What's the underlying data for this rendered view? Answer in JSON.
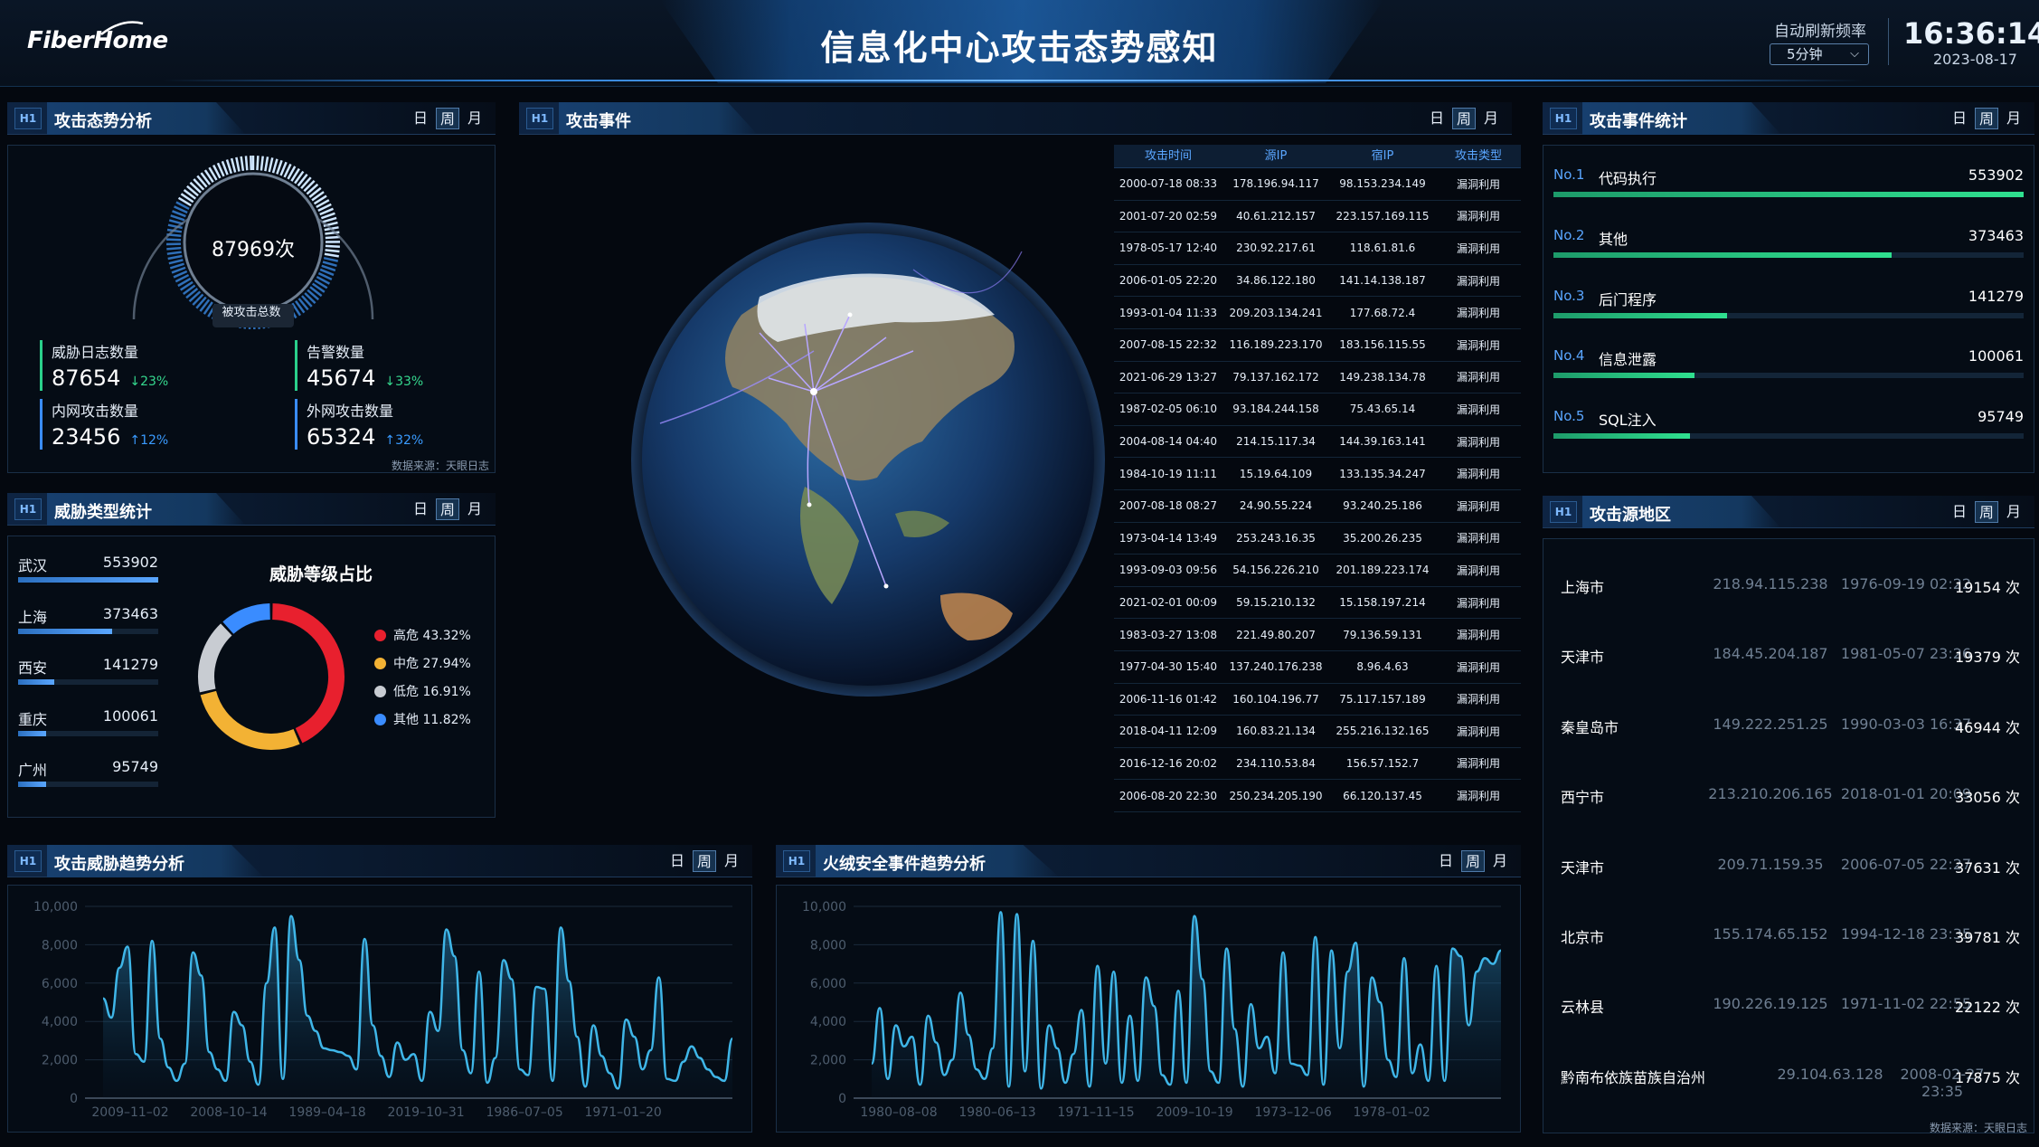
{
  "header": {
    "logo": "FiberHome",
    "title": "信息化中心攻击态势感知",
    "refresh_label": "自动刷新频率",
    "refresh_value": "5分钟",
    "time": "16:36:14",
    "date": "2023-08-17"
  },
  "tabs": {
    "day": "日",
    "week": "周",
    "month": "月"
  },
  "panel_icon_text": "H1",
  "attack_posture": {
    "title": "攻击态势分析",
    "total_value": "87969次",
    "total_label": "被攻击总数",
    "stats": [
      {
        "label": "威胁日志数量",
        "value": "87654",
        "change": "↓23%",
        "direction": "down"
      },
      {
        "label": "告警数量",
        "value": "45674",
        "change": "↓33%",
        "direction": "down"
      },
      {
        "label": "内网攻击数量",
        "value": "23456",
        "change": "↑12%",
        "direction": "up"
      },
      {
        "label": "外网攻击数量",
        "value": "65324",
        "change": "↑32%",
        "direction": "up"
      }
    ],
    "source": "数据来源：天眼日志"
  },
  "threat_type": {
    "title": "威胁类型统计",
    "cities": [
      {
        "name": "武汉",
        "value": "553902",
        "ratio": 1.0
      },
      {
        "name": "上海",
        "value": "373463",
        "ratio": 0.67
      },
      {
        "name": "西安",
        "value": "141279",
        "ratio": 0.26
      },
      {
        "name": "重庆",
        "value": "100061",
        "ratio": 0.2
      },
      {
        "name": "广州",
        "value": "95749",
        "ratio": 0.2
      }
    ],
    "donut_title": "威胁等级占比",
    "levels": [
      {
        "label": "高危 43.32%",
        "pct": 43.32,
        "color": "#e8202e"
      },
      {
        "label": "中危 27.94%",
        "pct": 27.94,
        "color": "#f3b234"
      },
      {
        "label": "低危 16.91%",
        "pct": 16.91,
        "color": "#c8ccd2"
      },
      {
        "label": "其他 11.82%",
        "pct": 11.82,
        "color": "#3a8cff"
      }
    ]
  },
  "attack_events": {
    "title": "攻击事件",
    "columns": [
      "攻击时间",
      "源IP",
      "宿IP",
      "攻击类型"
    ],
    "rows": [
      [
        "2000-07-18 08:33",
        "178.196.94.117",
        "98.153.234.149",
        "漏洞利用"
      ],
      [
        "2001-07-20 02:59",
        "40.61.212.157",
        "223.157.169.115",
        "漏洞利用"
      ],
      [
        "1978-05-17 12:40",
        "230.92.217.61",
        "118.61.81.6",
        "漏洞利用"
      ],
      [
        "2006-01-05 22:20",
        "34.86.122.180",
        "141.14.138.187",
        "漏洞利用"
      ],
      [
        "1993-01-04 11:33",
        "209.203.134.241",
        "177.68.72.4",
        "漏洞利用"
      ],
      [
        "2007-08-15 22:32",
        "116.189.223.170",
        "183.156.115.55",
        "漏洞利用"
      ],
      [
        "2021-06-29 13:27",
        "79.137.162.172",
        "149.238.134.78",
        "漏洞利用"
      ],
      [
        "1987-02-05 06:10",
        "93.184.244.158",
        "75.43.65.14",
        "漏洞利用"
      ],
      [
        "2004-08-14 04:40",
        "214.15.117.34",
        "144.39.163.141",
        "漏洞利用"
      ],
      [
        "1984-10-19 11:11",
        "15.19.64.109",
        "133.135.34.247",
        "漏洞利用"
      ],
      [
        "2007-08-18 08:27",
        "24.90.55.224",
        "93.240.25.186",
        "漏洞利用"
      ],
      [
        "1973-04-14 13:49",
        "253.243.16.35",
        "35.200.26.235",
        "漏洞利用"
      ],
      [
        "1993-09-03 09:56",
        "54.156.226.210",
        "201.189.223.174",
        "漏洞利用"
      ],
      [
        "2021-02-01 00:09",
        "59.15.210.132",
        "15.158.197.214",
        "漏洞利用"
      ],
      [
        "1983-03-27 13:08",
        "221.49.80.207",
        "79.136.59.131",
        "漏洞利用"
      ],
      [
        "1977-04-30 15:40",
        "137.240.176.238",
        "8.96.4.63",
        "漏洞利用"
      ],
      [
        "2006-11-16 01:42",
        "160.104.196.77",
        "75.117.157.189",
        "漏洞利用"
      ],
      [
        "2018-04-11 12:09",
        "160.83.21.134",
        "255.216.132.165",
        "漏洞利用"
      ],
      [
        "2016-12-16 20:02",
        "234.110.53.84",
        "156.57.152.7",
        "漏洞利用"
      ],
      [
        "2006-08-20 22:30",
        "250.234.205.190",
        "66.120.137.45",
        "漏洞利用"
      ]
    ]
  },
  "event_stats": {
    "title": "攻击事件统计",
    "items": [
      {
        "no": "No.1",
        "name": "代码执行",
        "value": "553902",
        "ratio": 1.0
      },
      {
        "no": "No.2",
        "name": "其他",
        "value": "373463",
        "ratio": 0.72
      },
      {
        "no": "No.3",
        "name": "后门程序",
        "value": "141279",
        "ratio": 0.37
      },
      {
        "no": "No.4",
        "name": "信息泄露",
        "value": "100061",
        "ratio": 0.3
      },
      {
        "no": "No.5",
        "name": "SQL注入",
        "value": "95749",
        "ratio": 0.29
      }
    ]
  },
  "source_region": {
    "title": "攻击源地区",
    "rows": [
      {
        "name": "上海市",
        "ip": "218.94.115.238",
        "time": "1976-09-19 02:22",
        "count": "19154 次"
      },
      {
        "name": "天津市",
        "ip": "184.45.204.187",
        "time": "1981-05-07 23:26",
        "count": "19379 次"
      },
      {
        "name": "秦皇岛市",
        "ip": "149.222.251.25",
        "time": "1990-03-03 16:37",
        "count": "46944 次"
      },
      {
        "name": "西宁市",
        "ip": "213.210.206.165",
        "time": "2018-01-01 20:09",
        "count": "33056 次"
      },
      {
        "name": "天津市",
        "ip": "209.71.159.35",
        "time": "2006-07-05 22:27",
        "count": "37631 次"
      },
      {
        "name": "北京市",
        "ip": "155.174.65.152",
        "time": "1994-12-18 23:35",
        "count": "39781 次"
      },
      {
        "name": "云林县",
        "ip": "190.226.19.125",
        "time": "1971-11-02 22:55",
        "count": "22122 次"
      },
      {
        "name": "黔南布依族苗族自治州",
        "ip": "29.104.63.128",
        "time": "2008-02-27 23:35",
        "count": "17875 次"
      }
    ],
    "source": "数据来源：天眼日志"
  },
  "trend_left_title": "攻击威胁趋势分析",
  "trend_right_title": "火绒安全事件趋势分析",
  "chart_data": [
    {
      "type": "area",
      "title": "攻击威胁趋势分析",
      "ylim": [
        0,
        10000
      ],
      "yticks": [
        "0",
        "2,000",
        "4,000",
        "6,000",
        "8,000",
        "10,000"
      ],
      "xticks": [
        "2009–11–02",
        "2008–10–14",
        "1989–04–18",
        "2019–10–31",
        "1986–07–05",
        "1971–01–20"
      ],
      "values": [
        5200,
        4200,
        6800,
        7900,
        2300,
        1900,
        8200,
        3100,
        1600,
        900,
        1800,
        7600,
        6400,
        2400,
        1500,
        900,
        4500,
        3800,
        1900,
        700,
        6000,
        8900,
        1000,
        9500,
        7200,
        4300,
        3500,
        2600,
        2500,
        2400,
        2200,
        1500,
        8300,
        3800,
        2200,
        1100,
        2900,
        2000,
        2300,
        900,
        4500,
        3500,
        8800,
        7400,
        2500,
        1300,
        6600,
        800,
        2100,
        7200,
        6200,
        1500,
        1200,
        5800,
        5700,
        900,
        8900,
        6100,
        3200,
        600,
        3800,
        2200,
        1300,
        500,
        4100,
        3200,
        1500,
        2500,
        6300,
        1000,
        900,
        1900,
        2700,
        2100,
        1500,
        1100,
        900,
        3100
      ]
    },
    {
      "type": "area",
      "title": "火绒安全事件趋势分析",
      "ylim": [
        0,
        10000
      ],
      "yticks": [
        "0",
        "2,000",
        "4,000",
        "6,000",
        "8,000",
        "10,000"
      ],
      "xticks": [
        "1980–08–08",
        "1980–06–13",
        "1971–11–15",
        "2009–10–19",
        "1973–12–06",
        "1978–01–02"
      ],
      "values": [
        1800,
        4700,
        1000,
        3800,
        2700,
        3200,
        700,
        4300,
        2900,
        1200,
        2000,
        5500,
        3300,
        1500,
        1000,
        2600,
        9700,
        600,
        9600,
        1400,
        8200,
        500,
        3800,
        2600,
        800,
        2300,
        4600,
        600,
        6900,
        1800,
        6600,
        800,
        4300,
        900,
        6300,
        4800,
        1200,
        700,
        5600,
        800,
        9500,
        6200,
        1400,
        800,
        7800,
        3600,
        600,
        4900,
        2600,
        3200,
        1300,
        7600,
        1800,
        1700,
        1200,
        8400,
        700,
        7700,
        2600,
        6600,
        8100,
        600,
        6300,
        5000,
        2000,
        1100,
        7300,
        1300,
        2800,
        900,
        6900,
        900,
        7800,
        7400,
        3800,
        6600,
        7300,
        7000,
        7700
      ]
    }
  ]
}
